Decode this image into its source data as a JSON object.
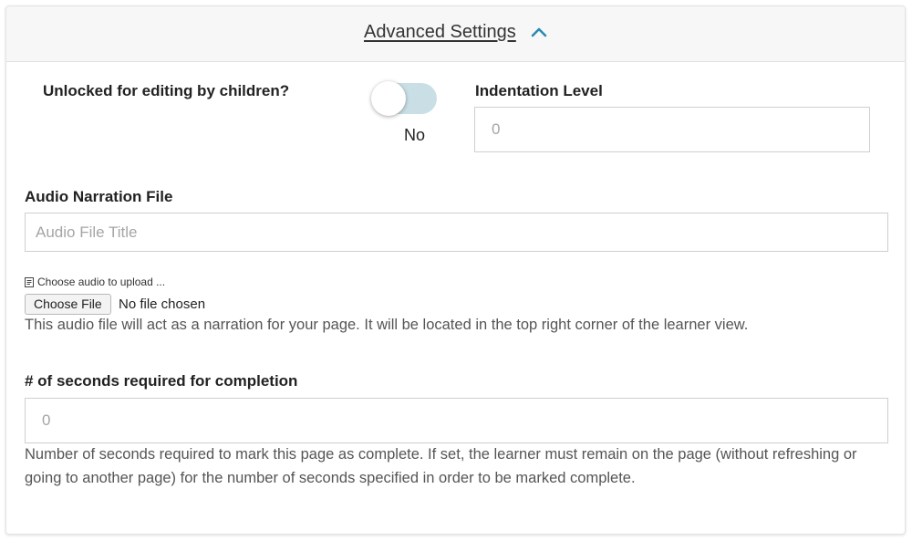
{
  "header": {
    "title": "Advanced Settings"
  },
  "unlocked": {
    "label": "Unlocked for editing by children?",
    "enabled": false,
    "state_text": "No"
  },
  "indentation": {
    "label": "Indentation Level",
    "placeholder": "0"
  },
  "audio": {
    "label": "Audio Narration File",
    "title_placeholder": "Audio File Title",
    "upload_caption": "Choose audio to upload ...",
    "choose_button": "Choose File",
    "no_file_text": "No file chosen",
    "help": "This audio file will act as a narration for your page. It will be located in the top right corner of the learner view."
  },
  "seconds": {
    "label": "# of seconds required for completion",
    "placeholder": "0",
    "help": "Number of seconds required to mark this page as complete. If set, the learner must remain on the page (without refreshing or going to another page) for the number of seconds specified in order to be marked complete."
  },
  "colors": {
    "accent": "#2a8ab0",
    "toggle_track": "#c9dfe5"
  },
  "icons": {
    "collapse": "chevron-up-icon",
    "file": "file-icon"
  }
}
